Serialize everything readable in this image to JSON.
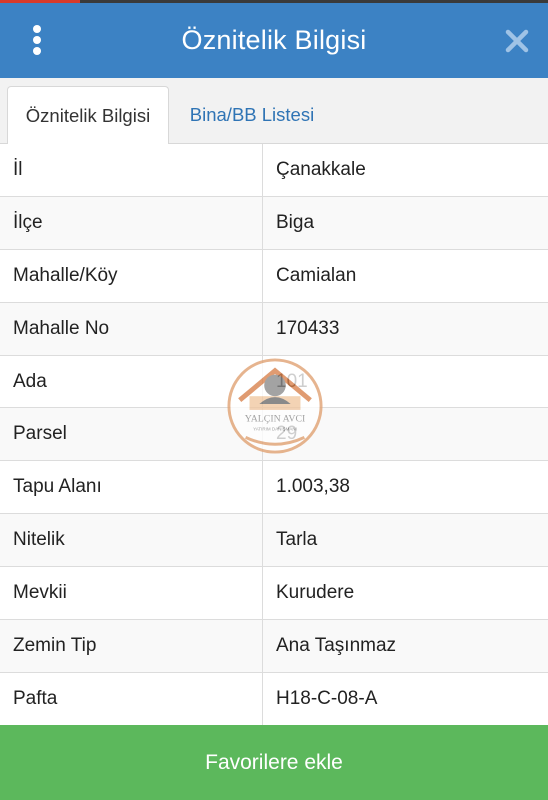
{
  "header": {
    "title": "Öznitelik Bilgisi"
  },
  "tabs": [
    {
      "label": "Öznitelik Bilgisi",
      "active": true
    },
    {
      "label": "Bina/BB Listesi",
      "active": false
    }
  ],
  "rows": [
    {
      "key": "İl",
      "value": "Çanakkale"
    },
    {
      "key": "İlçe",
      "value": "Biga"
    },
    {
      "key": "Mahalle/Köy",
      "value": "Camialan"
    },
    {
      "key": "Mahalle No",
      "value": "170433"
    },
    {
      "key": "Ada",
      "value": "101"
    },
    {
      "key": "Parsel",
      "value": "29"
    },
    {
      "key": "Tapu Alanı",
      "value": "1.003,38"
    },
    {
      "key": "Nitelik",
      "value": "Tarla"
    },
    {
      "key": "Mevkii",
      "value": "Kurudere"
    },
    {
      "key": "Zemin Tip",
      "value": "Ana Taşınmaz"
    },
    {
      "key": "Pafta",
      "value": "H18-C-08-A"
    }
  ],
  "bottom_button": {
    "label": "Favorilere ekle"
  },
  "watermark": {
    "name": "YALÇIN AVCI",
    "sub": "YATIRIM DANIŞMANI"
  },
  "colors": {
    "header": "#3c82c4",
    "tab_active_text": "#333333",
    "tab_link": "#2f74b5",
    "button": "#5cb85c"
  }
}
